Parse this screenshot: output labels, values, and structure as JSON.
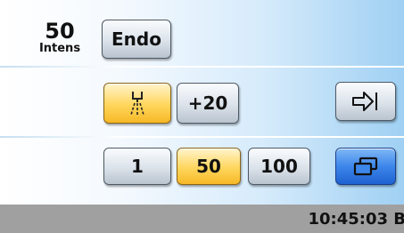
{
  "intensity": {
    "value": "50",
    "label": "Intens"
  },
  "buttons": {
    "endo": "Endo",
    "plus20": "+20",
    "step1": "1",
    "step50": "50",
    "step100": "100"
  },
  "icons": {
    "spray": "spray-icon",
    "enter": "enter-arrow-icon",
    "window": "window-icon"
  },
  "status": {
    "time": "10:45:03 B"
  },
  "colors": {
    "active": "#ffd65c",
    "blue": "#3d86ea",
    "statusbar": "#a0a0a0"
  }
}
